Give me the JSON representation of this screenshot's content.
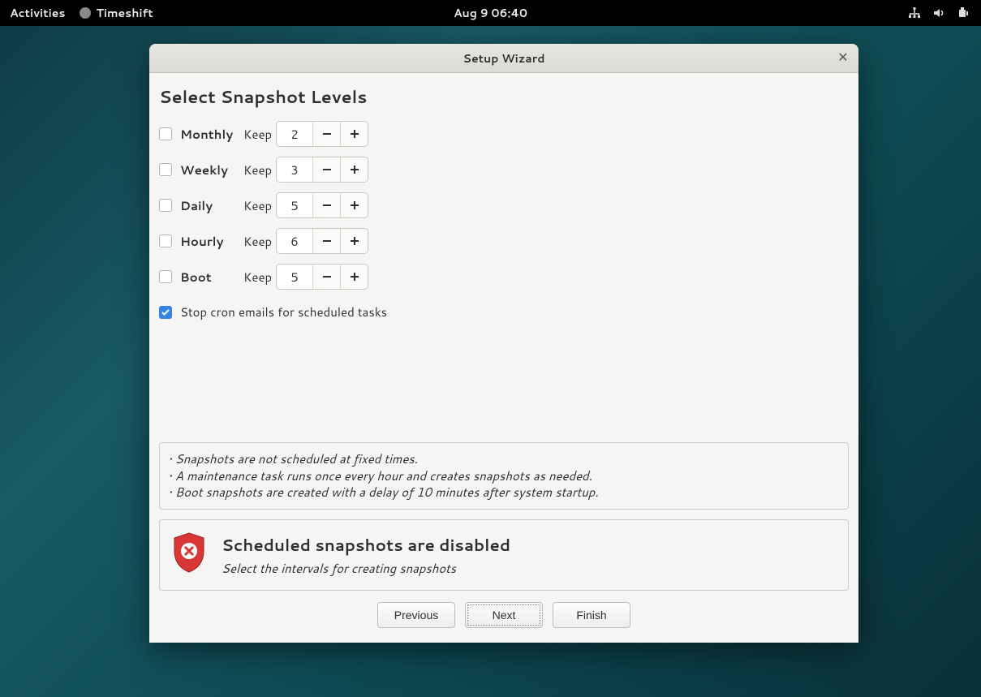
{
  "topbar": {
    "activities": "Activities",
    "app_name": "Timeshift",
    "datetime": "Aug 9  06:40"
  },
  "window": {
    "title": "Setup Wizard"
  },
  "page": {
    "heading": "Select Snapshot Levels",
    "keep_label": "Keep",
    "levels": {
      "monthly": {
        "label": "Monthly",
        "checked": false,
        "value": "2"
      },
      "weekly": {
        "label": "Weekly",
        "checked": false,
        "value": "3"
      },
      "daily": {
        "label": "Daily",
        "checked": false,
        "value": "5"
      },
      "hourly": {
        "label": "Hourly",
        "checked": false,
        "value": "6"
      },
      "boot": {
        "label": "Boot",
        "checked": false,
        "value": "5"
      }
    },
    "cron": {
      "label": "Stop cron emails for scheduled tasks",
      "checked": true
    },
    "info": {
      "line1": "• Snapshots are not scheduled at fixed times.",
      "line2": "• A maintenance task runs once every hour and creates snapshots as needed.",
      "line3": "• Boot snapshots are created with a delay of 10 minutes after system startup."
    },
    "warning": {
      "title": "Scheduled snapshots are disabled",
      "subtitle": "Select the intervals for creating snapshots"
    }
  },
  "footer": {
    "previous": "Previous",
    "next": "Next",
    "finish": "Finish"
  }
}
